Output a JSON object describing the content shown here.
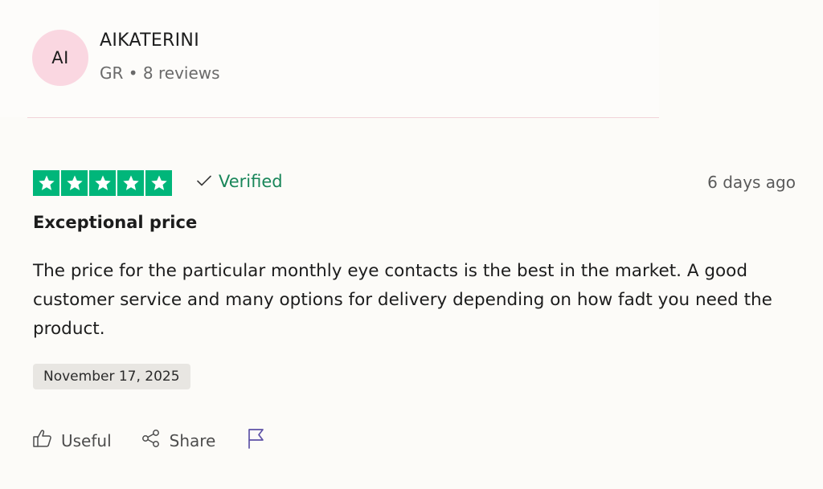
{
  "reviewer": {
    "initials": "AI",
    "name": "AIKATERINI",
    "meta": "GR • 8 reviews"
  },
  "review": {
    "rating": 5,
    "verified_label": "Verified",
    "posted_ago": "6 days ago",
    "title": "Exceptional price",
    "body": "The price for the particular monthly eye contacts is the best in the market. A good customer service and many options for delivery depending on how fadt you need the product.",
    "experience_date": "November 17, 2025"
  },
  "actions": {
    "useful_label": "Useful",
    "share_label": "Share",
    "report_icon": "flag-icon"
  },
  "colors": {
    "star_green": "#00b67a",
    "verified_green": "#19865a",
    "avatar_pink": "#fad7e1",
    "flag_purple": "#5d52a6"
  }
}
